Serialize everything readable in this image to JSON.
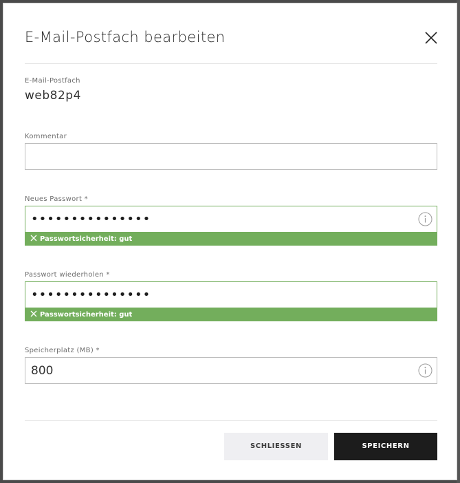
{
  "dialog": {
    "title": "E-Mail-Postfach bearbeiten"
  },
  "mailbox": {
    "label": "E-Mail-Postfach",
    "value": "web82p4"
  },
  "comment": {
    "label": "Kommentar",
    "value": ""
  },
  "new_password": {
    "label": "Neues Passwort *",
    "masked_value": "•••••••••••••••",
    "strength": "Passwortsicherheit: gut"
  },
  "repeat_password": {
    "label": "Passwort wiederholen *",
    "masked_value": "•••••••••••••••",
    "strength": "Passwortsicherheit: gut"
  },
  "storage": {
    "label": "Speicherplatz (MB) *",
    "value": "800"
  },
  "buttons": {
    "close": "SCHLIESSEN",
    "save": "SPEICHERN"
  },
  "colors": {
    "success": "#73ae5c",
    "primary_button": "#1c1c1c",
    "secondary_button": "#efeff2"
  },
  "icons": {
    "close": "close-icon",
    "info": "info-icon",
    "strength_mark": "x-icon"
  }
}
